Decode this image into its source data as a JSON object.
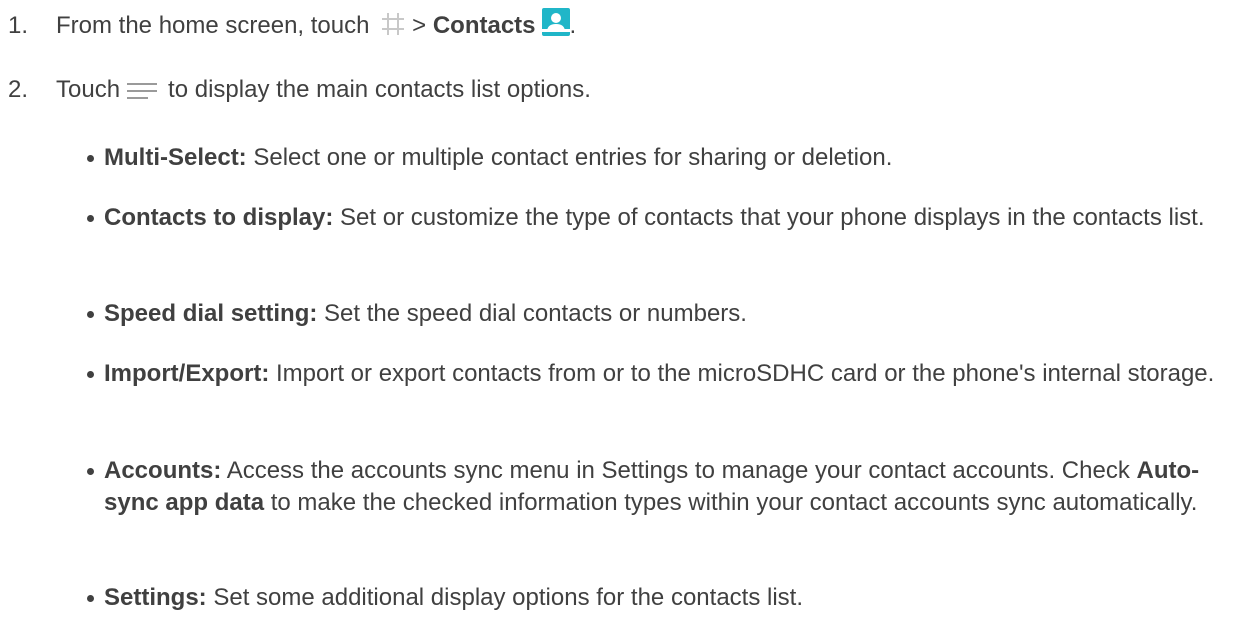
{
  "steps": [
    {
      "number": "1.",
      "pre": "From the home screen, touch",
      "sep": ">",
      "bold": "Contacts",
      "post": "."
    },
    {
      "number": "2.",
      "pre": "Touch",
      "post": "to display the main contacts list options."
    }
  ],
  "options": [
    {
      "term": "Multi-Select:",
      "desc": "Select one or multiple contact entries for sharing or deletion."
    },
    {
      "term": "Contacts to display:",
      "desc": "Set or customize the type of contacts that your phone displays in the contacts list."
    },
    {
      "term": "Speed dial setting:",
      "desc": "Set the speed dial contacts or numbers."
    },
    {
      "term": "Import/Export:",
      "desc": "Import or export contacts from or to the microSDHC card or the phone's internal storage."
    },
    {
      "term": "Accounts:",
      "desc": "Access the accounts sync menu in Settings to manage your contact accounts. Check",
      "bold2": "Auto-sync app data",
      "desc2": "to make the checked information types within your contact accounts sync automatically."
    },
    {
      "term": "Settings:",
      "desc": "Set some additional display options for the contacts list."
    }
  ],
  "icons": {
    "apps": "apps-grid-icon",
    "contacts": "contacts-icon",
    "menu": "menu-icon"
  },
  "colors": {
    "text": "#404040",
    "contacts_icon_bg": "#20B6C8"
  }
}
